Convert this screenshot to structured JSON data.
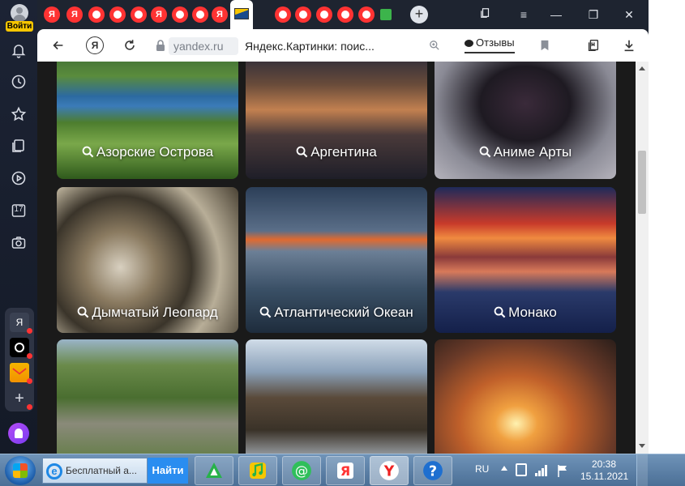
{
  "sidebar": {
    "login_label": "Войти",
    "calendar_day": "17",
    "apps": [
      "Я",
      "music",
      "mail",
      "add"
    ]
  },
  "tabs": {
    "ya_letter": "Я"
  },
  "address_bar": {
    "domain": "yandex.ru",
    "title": "Яндекс.Картинки: поис...",
    "reviews_label": "Отзывы"
  },
  "cards": [
    {
      "label": "Азорские Острова"
    },
    {
      "label": "Аргентина"
    },
    {
      "label": "Аниме Арты"
    },
    {
      "label": "Дымчатый Леопард"
    },
    {
      "label": "Атлантический Океан"
    },
    {
      "label": "Монако"
    },
    {
      "label": ""
    },
    {
      "label": ""
    },
    {
      "label": ""
    }
  ],
  "taskbar": {
    "ie_text": "Бесплатный а...",
    "go_button": "Найти",
    "language": "RU",
    "time": "20:38",
    "date": "15.11.2021"
  },
  "colors": {
    "yandex_red": "#ff3333",
    "login_yellow": "#f7c600",
    "page_background": "#1a1a1a"
  }
}
